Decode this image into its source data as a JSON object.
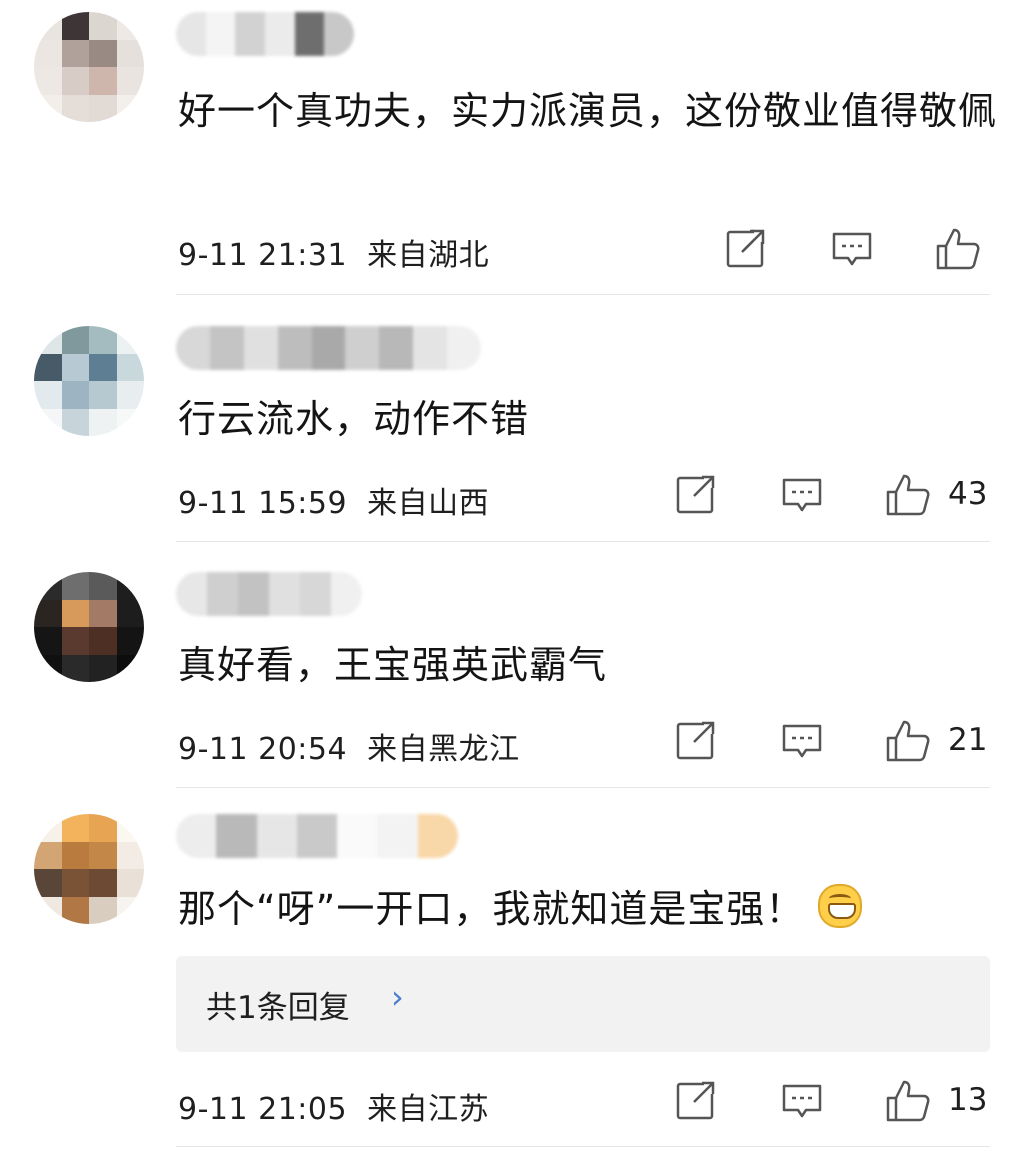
{
  "comments": [
    {
      "text": "好一个真功夫，实力派演员，这份敬业值得敬佩",
      "time": "9-11 21:31",
      "location": "来自湖北",
      "likes": ""
    },
    {
      "text": "行云流水，动作不错",
      "time": "9-11 15:59",
      "location": "来自山西",
      "likes": "43"
    },
    {
      "text": "真好看，王宝强英武霸气",
      "time": "9-11 20:54",
      "location": "来自黑龙江",
      "likes": "21"
    },
    {
      "text": "那个“呀”一开口，我就知道是宝强！",
      "emoji": "grinning-face-icon",
      "reply_summary": "共1条回复",
      "reply_chevron": "›",
      "time": "9-11 21:05",
      "location": "来自江苏",
      "likes": "13"
    }
  ],
  "colors": {
    "accent": "#4a7dd0",
    "divider": "#e6e6e6",
    "reply_bg": "#f2f2f2",
    "icon_stroke": "#555555"
  },
  "icons": [
    "share-icon",
    "comment-icon",
    "like-icon"
  ]
}
